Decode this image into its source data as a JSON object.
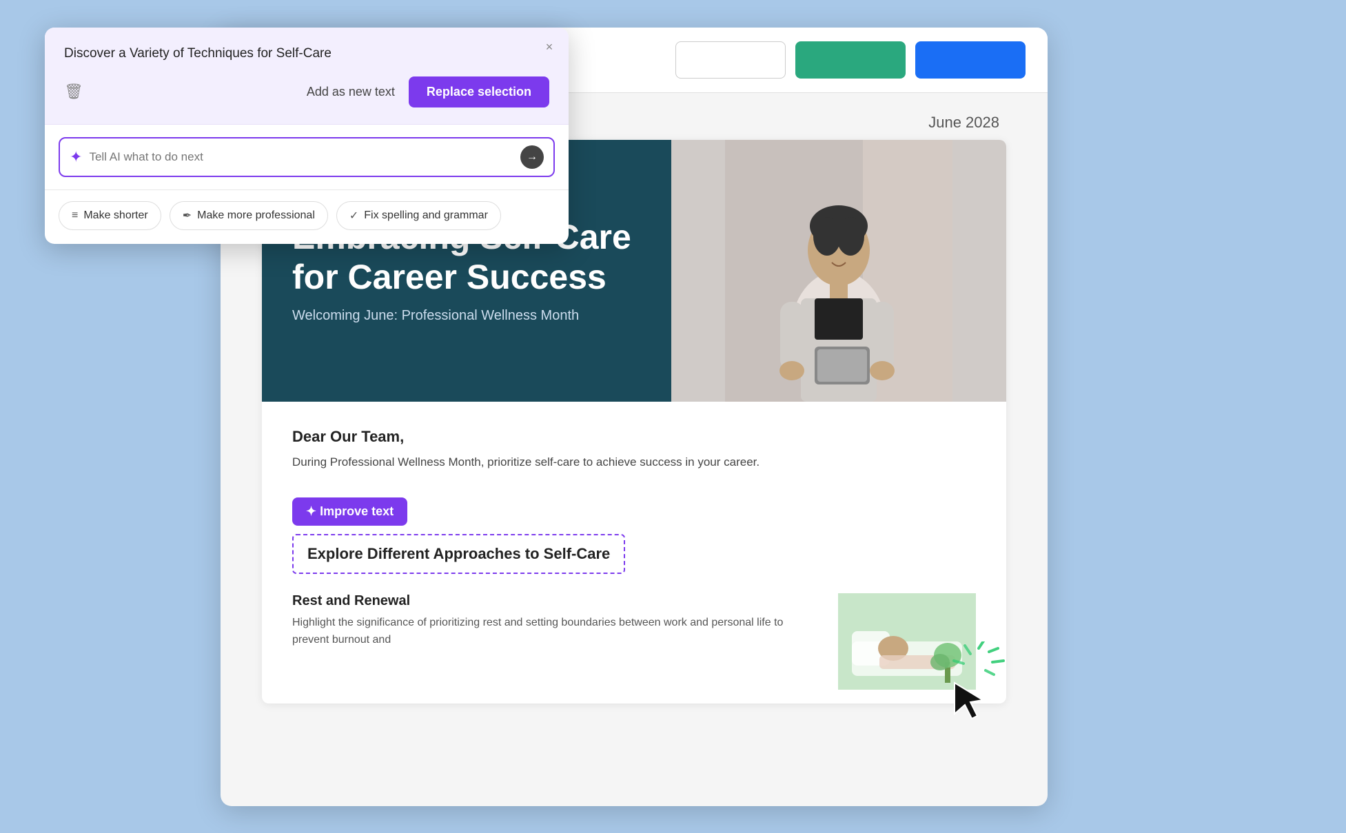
{
  "popup": {
    "close_label": "×",
    "suggestion": {
      "text": "Discover a Variety of Techniques for Self-Care"
    },
    "actions": {
      "delete_label": "🗑",
      "add_as_new_label": "Add as new text",
      "replace_label": "Replace selection"
    },
    "input": {
      "placeholder": "Tell AI what to do next",
      "send_icon": "→"
    },
    "chips": [
      {
        "icon": "≡",
        "label": "Make shorter"
      },
      {
        "icon": "✒",
        "label": "Make more professional"
      },
      {
        "icon": "✓",
        "label": "Fix spelling and grammar"
      }
    ]
  },
  "toolbar": {
    "btn1_label": "",
    "btn2_label": "",
    "btn3_label": ""
  },
  "newsletter": {
    "date": "June 2028",
    "hero_title": "Embracing Self-Care for Career Success",
    "hero_subtitle": "Welcoming June: Professional Wellness Month",
    "dear": "Dear Our Team,",
    "intro": "During Professional Wellness Month, prioritize self-care to achieve success in your career.",
    "improve_text_btn": "✦ Improve text",
    "selected_heading": "Explore Different Approaches to Self-Care",
    "rest_title": "Rest and Renewal",
    "rest_body": "Highlight the significance of prioritizing rest and setting boundaries between work and personal life to prevent burnout and"
  }
}
